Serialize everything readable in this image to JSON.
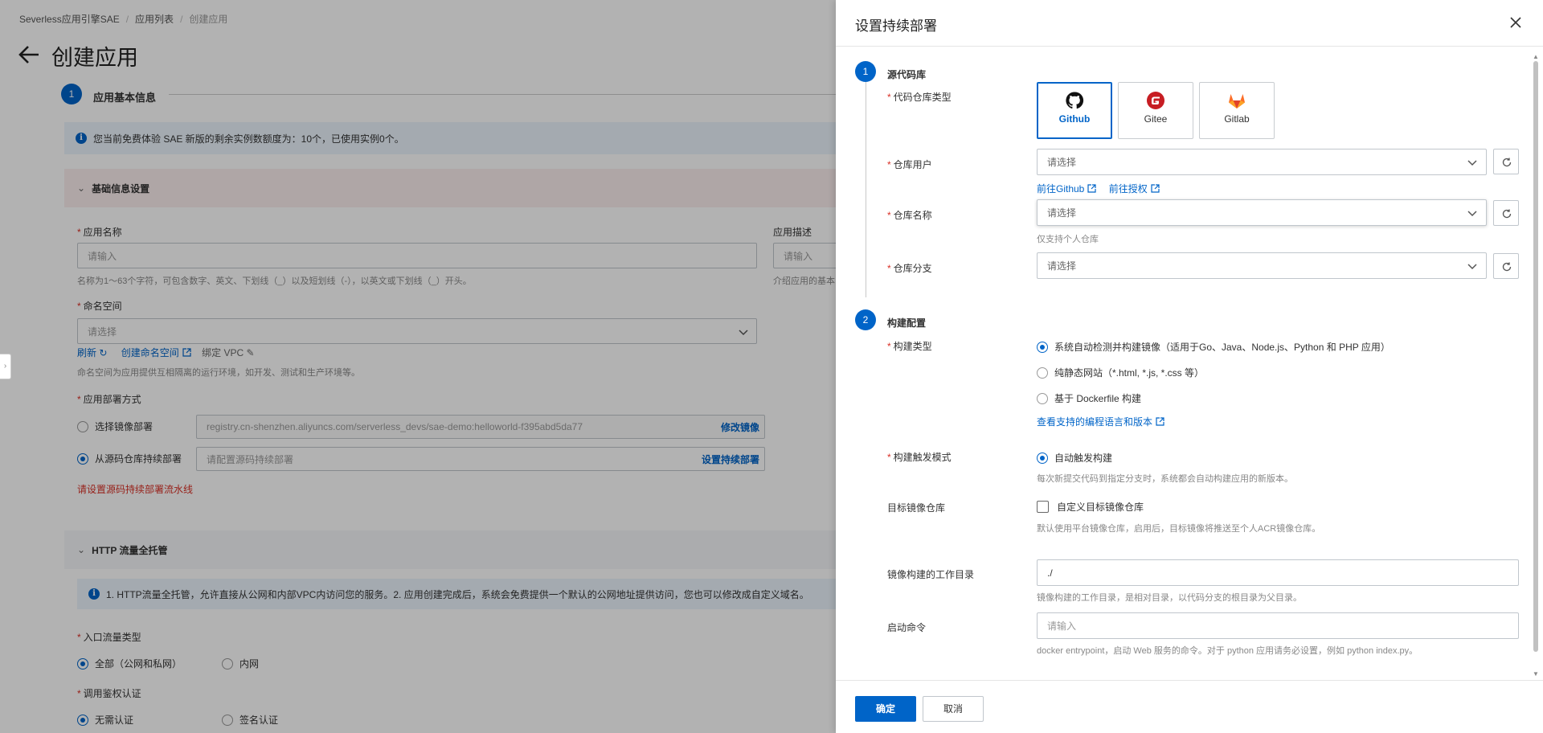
{
  "background": {
    "breadcrumb": [
      "Severless应用引擎SAE",
      "应用列表",
      "创建应用"
    ],
    "page_title": "创建应用",
    "step1": {
      "num": "1",
      "label": "应用基本信息"
    },
    "notice": "您当前免费体验 SAE 新版的剩余实例数额度为：10个，已使用实例0个。",
    "basic_section": "基础信息设置",
    "app_name": {
      "label": "应用名称",
      "placeholder": "请输入",
      "hint": "名称为1～63个字符，可包含数字、英文、下划线（_）以及短划线（-），以英文或下划线（_）开头。"
    },
    "app_desc": {
      "label": "应用描述",
      "placeholder": "请输入",
      "hint": "介绍应用的基本"
    },
    "namespace": {
      "label": "命名空间",
      "placeholder": "请选择",
      "refresh": "刷新",
      "create": "创建命名空间",
      "bind_vpc": "绑定 VPC",
      "hint": "命名空间为应用提供互相隔离的运行环境，如开发、测试和生产环境等。"
    },
    "deploy_mode": {
      "label": "应用部署方式",
      "image_option": "选择镜像部署",
      "image_value": "registry.cn-shenzhen.aliyuncs.com/serverless_devs/sae-demo:helloworld-f395abd5da77",
      "image_action": "修改镜像",
      "source_option": "从源码仓库持续部署",
      "source_placeholder": "请配置源码持续部署",
      "source_action": "设置持续部署",
      "error": "请设置源码持续部署流水线"
    },
    "http_section": "HTTP 流量全托管",
    "http_notice": "1. HTTP流量全托管，允许直接从公网和内部VPC内访问您的服务。2. 应用创建完成后，系统会免费提供一个默认的公网地址提供访问，您也可以修改成自定义域名。",
    "ingress": {
      "label": "入口流量类型",
      "opt_all": "全部（公网和私网）",
      "opt_internal": "内网"
    },
    "auth": {
      "label": "调用鉴权认证",
      "opt_none": "无需认证",
      "opt_sign": "签名认证"
    }
  },
  "drawer": {
    "title": "设置持续部署",
    "step1": {
      "num": "1",
      "label": "源代码库"
    },
    "repo_type": {
      "label": "代码仓库类型",
      "options": [
        "Github",
        "Gitee",
        "Gitlab"
      ],
      "selected": "Github"
    },
    "repo_user": {
      "label": "仓库用户",
      "placeholder": "请选择",
      "link_github": "前往Github",
      "link_auth": "前往授权"
    },
    "repo_name": {
      "label": "仓库名称",
      "placeholder": "请选择",
      "hint": "仅支持个人仓库"
    },
    "repo_branch": {
      "label": "仓库分支",
      "placeholder": "请选择"
    },
    "step2": {
      "num": "2",
      "label": "构建配置"
    },
    "build_type": {
      "label": "构建类型",
      "options": [
        "系统自动检测并构建镜像（适用于Go、Java、Node.js、Python 和 PHP 应用）",
        "纯静态网站（*.html, *.js, *.css 等）",
        "基于 Dockerfile 构建"
      ],
      "link": "查看支持的编程语言和版本"
    },
    "trigger": {
      "label": "构建触发模式",
      "option": "自动触发构建",
      "hint": "每次新提交代码到指定分支时，系统都会自动构建应用的新版本。"
    },
    "target_repo": {
      "label": "目标镜像仓库",
      "option": "自定义目标镜像仓库",
      "hint": "默认使用平台镜像仓库，启用后，目标镜像将推送至个人ACR镜像仓库。"
    },
    "workdir": {
      "label": "镜像构建的工作目录",
      "value": "./",
      "hint": "镜像构建的工作目录，是相对目录，以代码分支的根目录为父目录。"
    },
    "start_cmd": {
      "label": "启动命令",
      "placeholder": "请输入",
      "hint": "docker entrypoint，启动 Web 服务的命令。对于 python 应用请务必设置，例如 python index.py。"
    },
    "confirm": "确定",
    "cancel": "取消"
  },
  "colors": {
    "primary": "#0064c8",
    "error": "#d93026",
    "required": "#d93026"
  }
}
